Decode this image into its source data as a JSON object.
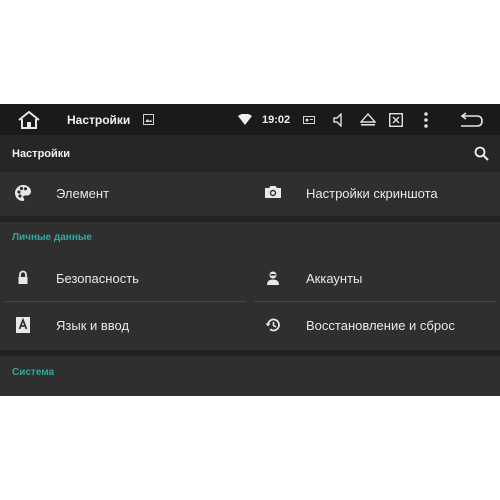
{
  "status_bar": {
    "title": "Настройки",
    "time": "19:02",
    "icons": [
      "home-icon",
      "image-notification-icon",
      "wifi-icon",
      "radio-icon",
      "volume-icon",
      "eject-icon",
      "close-window-icon",
      "more-icon",
      "back-icon"
    ]
  },
  "action_bar": {
    "title": "Настройки",
    "search_icon": "search-icon"
  },
  "sections": {
    "personal_header": "Личные данные",
    "system_header": "Система"
  },
  "items": {
    "element": {
      "label": "Элемент",
      "icon": "palette-icon"
    },
    "screenshot": {
      "label": "Настройки скриншота",
      "icon": "camera-icon"
    },
    "security": {
      "label": "Безопасность",
      "icon": "lock-icon"
    },
    "accounts": {
      "label": "Аккаунты",
      "icon": "account-icon"
    },
    "language": {
      "label": "Язык и ввод",
      "icon": "keyboard-letter-icon"
    },
    "backup": {
      "label": "Восстановление и сброс",
      "icon": "restore-icon"
    }
  },
  "colors": {
    "accent": "#2fa9a0",
    "background": "#2b2b2b",
    "statusbar": "#1a1a1a"
  }
}
